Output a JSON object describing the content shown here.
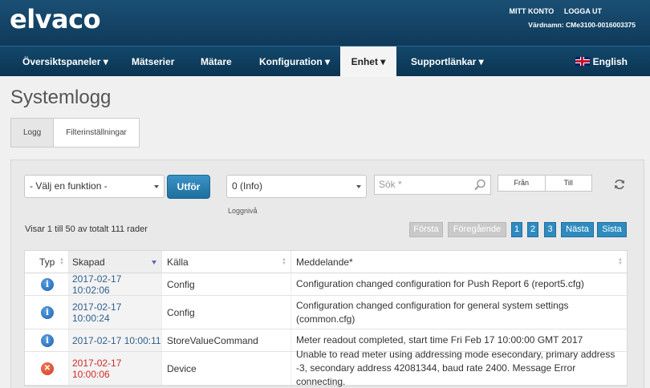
{
  "brand": {
    "logo": "elvaco"
  },
  "top_links": {
    "account": "MITT KONTO",
    "logout": "LOGGA UT",
    "hostname": "Värdnamn: CMe3100-0016003375"
  },
  "nav": {
    "items": [
      "Översiktspaneler ▾",
      "Mätserier",
      "Mätare",
      "Konfiguration ▾",
      "Enhet ▾",
      "Supportlänkar ▾"
    ],
    "active_index": 4,
    "language": "English"
  },
  "page": {
    "title": "Systemlogg"
  },
  "tabs": [
    {
      "label": "Logg",
      "active": true
    },
    {
      "label": "Filterinställningar",
      "active": false
    }
  ],
  "controls": {
    "function_select": "- Välj en funktion -",
    "run_button": "Utför",
    "level_select": "0 (Info)",
    "level_label": "Loggnivå",
    "search_placeholder": "Sök *",
    "from_label": "Från",
    "to_label": "Till"
  },
  "pagination": {
    "summary": "Visar 1 till 50 av totalt 111 rader",
    "first": "Första",
    "previous": "Föregående",
    "pages": [
      "1",
      "2",
      "3"
    ],
    "current_page": "1",
    "next": "Nästa",
    "last": "Sista"
  },
  "table": {
    "headers": [
      "Typ",
      "Skapad",
      "Källa",
      "Meddelande*"
    ],
    "rows": [
      {
        "type": "info",
        "created": "2017-02-17 10:02:06",
        "source": "Config",
        "message": "Configuration changed configuration for Push Report 6 (report5.cfg)"
      },
      {
        "type": "info",
        "created": "2017-02-17 10:00:24",
        "source": "Config",
        "message": "Configuration changed configuration for general system settings (common.cfg)"
      },
      {
        "type": "info",
        "created": "2017-02-17 10:00:11",
        "source": "StoreValueCommand",
        "message": "Meter readout completed, start time Fri Feb 17 10:00:00 GMT 2017"
      },
      {
        "type": "error",
        "created": "2017-02-17 10:00:06",
        "source": "Device",
        "message": "Unable to read meter using addressing mode esecondary, primary address -3, secondary address 42081344, baud rate 2400. Message Error connecting."
      }
    ]
  },
  "colors": {
    "header_bg": "#0f3a59",
    "accent": "#2f8bbf",
    "date_text": "#2d5f8e",
    "error_text": "#d12b2b"
  },
  "icons": {
    "info": "info-circle-icon",
    "error": "error-x-icon",
    "search": "search-icon",
    "refresh": "refresh-icon",
    "flag": "uk-flag-icon"
  }
}
